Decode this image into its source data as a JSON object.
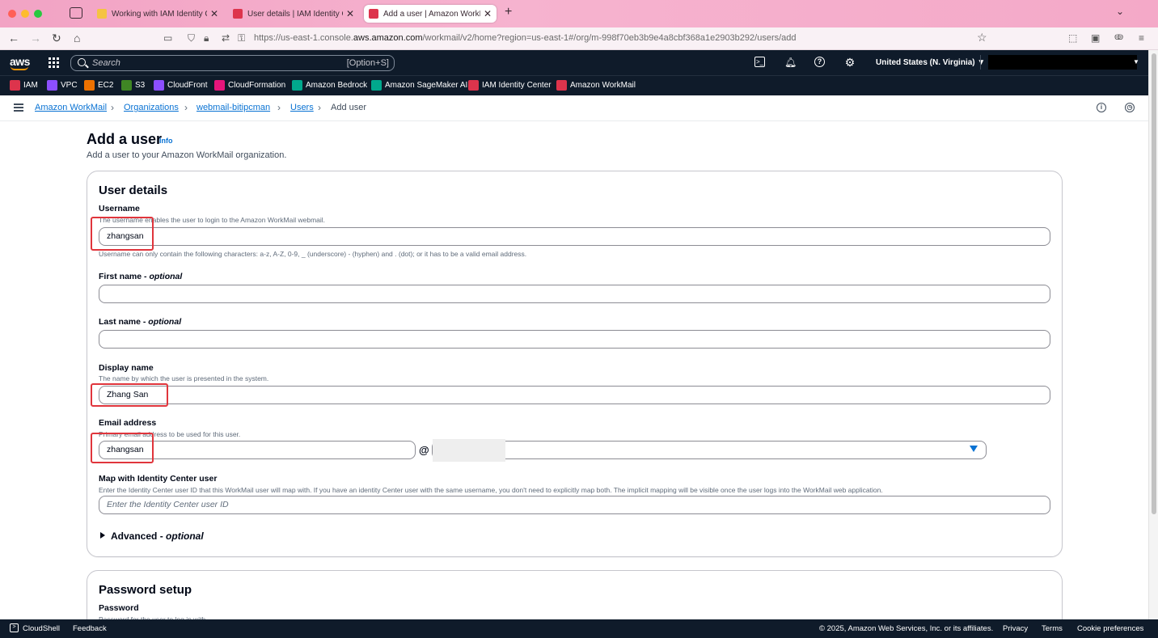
{
  "browser": {
    "tabs": [
      {
        "title": "Working with IAM Identity Cente",
        "favicon_color": "#f5c342",
        "active": false
      },
      {
        "title": "User details | IAM Identity Cente",
        "favicon_color": "#dd344c",
        "active": false
      },
      {
        "title": "Add a user | Amazon WorkMail |",
        "favicon_color": "#dd344c",
        "active": true
      }
    ],
    "url_prefix": "https://us-east-1.console.",
    "url_domain": "aws.amazon.com",
    "url_path": "/workmail/v2/home?region=us-east-1#/org/m-998f70eb3b9e4a8cbf368a1e2903b292/users/add"
  },
  "aws_nav": {
    "logo": "aws",
    "search_placeholder": "Search",
    "search_shortcut": "[Option+S]",
    "region": "United States (N. Virginia) ▼"
  },
  "favorites": [
    {
      "label": "IAM",
      "color": "#dd344c"
    },
    {
      "label": "VPC",
      "color": "#8c4fff"
    },
    {
      "label": "EC2",
      "color": "#ed7100"
    },
    {
      "label": "S3",
      "color": "#3f8624"
    },
    {
      "label": "CloudFront",
      "color": "#8c4fff"
    },
    {
      "label": "CloudFormation",
      "color": "#e7157b"
    },
    {
      "label": "Amazon Bedrock",
      "color": "#01a88d"
    },
    {
      "label": "Amazon SageMaker AI",
      "color": "#01a88d"
    },
    {
      "label": "IAM Identity Center",
      "color": "#dd344c"
    },
    {
      "label": "Amazon WorkMail",
      "color": "#dd344c"
    }
  ],
  "breadcrumb": [
    "Amazon WorkMail",
    "Organizations",
    "webmail-bitipcman",
    "Users",
    "Add user"
  ],
  "page": {
    "title": "Add a user",
    "info": "Info",
    "description": "Add a user to your Amazon WorkMail organization."
  },
  "user_details": {
    "title": "User details",
    "username": {
      "label": "Username",
      "description": "The username enables the user to login to the Amazon WorkMail webmail.",
      "value": "zhangsan",
      "constraint": "Username can only contain the following characters: a-z, A-Z, 0-9, _ (underscore) - (hyphen) and . (dot); or it has to be a valid email address."
    },
    "first_name": {
      "label": "First name",
      "optional": "optional",
      "value": ""
    },
    "last_name": {
      "label": "Last name",
      "optional": "optional",
      "value": ""
    },
    "display_name": {
      "label": "Display name",
      "description": "The name by which the user is presented in the system.",
      "value": "Zhang San"
    },
    "email": {
      "label": "Email address",
      "description": "Primary email address to be used for this user.",
      "local_value": "zhangsan",
      "at": "@"
    },
    "identity_center": {
      "label": "Map with Identity Center user",
      "description": "Enter the Identity Center user ID that this WorkMail user will map with. If you have an identity Center user with the same username, you don't need to explicitly map both. The implicit mapping will be visible once the user logs into the WorkMail web application.",
      "placeholder": "Enter the Identity Center user ID"
    },
    "advanced": {
      "label": "Advanced",
      "optional": "optional"
    }
  },
  "password_setup": {
    "title": "Password setup",
    "password_label": "Password",
    "password_description": "Password for the user to log in with."
  },
  "footer": {
    "cloudshell": "CloudShell",
    "feedback": "Feedback",
    "copyright": "© 2025, Amazon Web Services, Inc. or its affiliates.",
    "privacy": "Privacy",
    "terms": "Terms",
    "cookies": "Cookie preferences"
  },
  "colors": {
    "aws_nav_bg": "#0f1b2a",
    "link": "#0972d3",
    "highlight_box": "#e0353c",
    "aws_orange": "#ff9900"
  }
}
